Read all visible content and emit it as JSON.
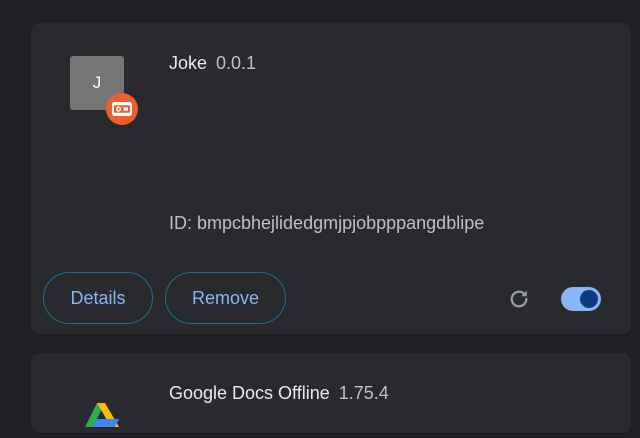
{
  "extensions": [
    {
      "name": "Joke",
      "version": "0.0.1",
      "icon_letter": "J",
      "id_text": "ID: bmpcbhejlidedgmjpjobpppangdblipe",
      "details_label": "Details",
      "remove_label": "Remove",
      "enabled": true,
      "source_badge_icon": "unpacked-source-icon",
      "reload_icon": "reload-icon"
    },
    {
      "name": "Google Docs Offline",
      "version": "1.75.4",
      "icon": "google-docs-offline-icon"
    }
  ],
  "colors": {
    "background": "#202124",
    "card": "#292a2d",
    "accent": "#8ab4f8",
    "badge": "#ec5e2d",
    "toggle_knob": "#0e3a83"
  }
}
